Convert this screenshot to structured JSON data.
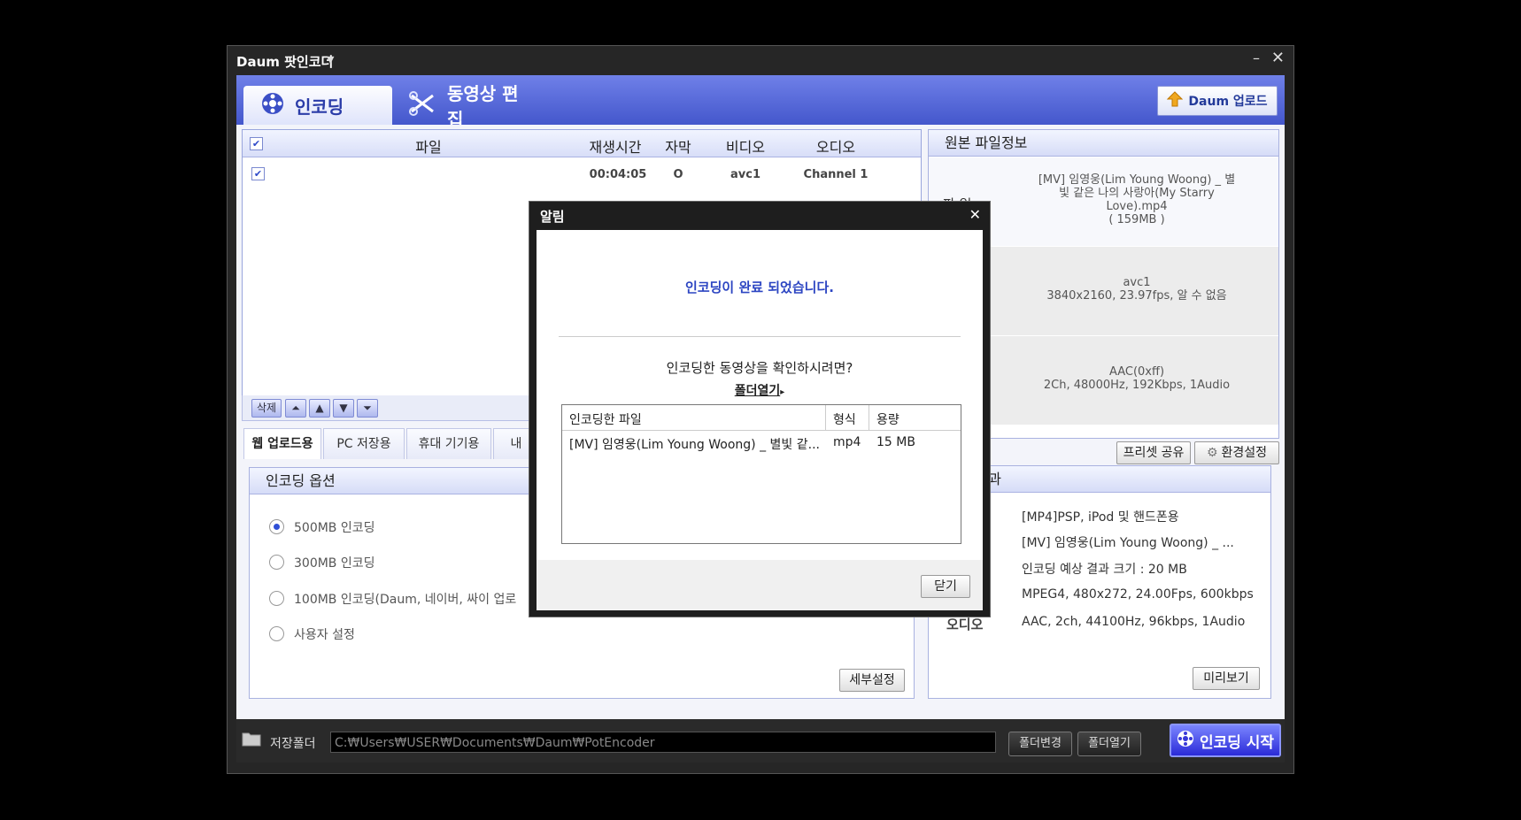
{
  "window": {
    "title": "Daum 팟인코더",
    "caret": "▼",
    "minimize": "–",
    "close": "✕"
  },
  "tabs": {
    "encode": "인코딩",
    "edit": "동영상 편집",
    "upload_btn": "Daum 업로드"
  },
  "filelist": {
    "columns": [
      "파일",
      "재생시간",
      "자막",
      "비디오",
      "오디오"
    ],
    "rows": [
      {
        "checked": true,
        "file": "",
        "duration": "00:04:05",
        "subtitle": "O",
        "video": "avc1",
        "audio": "Channel 1"
      }
    ],
    "delete_btn": "삭제",
    "arrows": [
      "⏶",
      "▲",
      "▼",
      "⏷"
    ]
  },
  "option_tabs": [
    "웹 업로드용",
    "PC 저장용",
    "휴대 기기용",
    "내"
  ],
  "encode_options": {
    "header": "인코딩 옵션",
    "items": [
      {
        "label": "500MB 인코딩",
        "selected": true
      },
      {
        "label": "300MB 인코딩",
        "selected": false
      },
      {
        "label": "100MB 인코딩(Daum, 네이버, 싸이 업로",
        "selected": false
      },
      {
        "label": "사용자 설정",
        "selected": false
      }
    ],
    "detail_btn": "세부설정"
  },
  "source_info": {
    "header": "원본 파일정보",
    "file_label": "파 일",
    "file_lines": [
      "[MV] 임영웅(Lim Young Woong) _ 별",
      "빛 같은 나의 사랑아(My Starry",
      "Love).mp4",
      "( 159MB )"
    ],
    "video_lines": [
      "avc1",
      "3840x2160, 23.97fps, 알 수 없음"
    ],
    "audio_lines": [
      "AAC(0xff)",
      "2Ch, 48000Hz, 192Kbps, 1Audio"
    ]
  },
  "preset_share_btn": "프리셋 공유",
  "settings_btn": "환경설정",
  "result": {
    "header": "코딩 결과",
    "lines": [
      "[MP4]PSP, iPod 및 핸드폰용",
      "[MV] 임영웅(Lim Young Woong) _ ...",
      "인코딩 예상 결과 크기 : 20 MB",
      "MPEG4, 480x272, 24.00Fps, 600kbps",
      "AAC, 2ch, 44100Hz, 96kbps, 1Audio"
    ],
    "audio_label": "오디오",
    "preview_btn": "미리보기"
  },
  "bottom": {
    "folder_label": "저장폴더",
    "path": "C:₩Users₩USER₩Documents₩Daum₩PotEncoder",
    "change_btn": "폴더변경",
    "open_btn": "폴더열기",
    "start_btn": "인코딩 시작"
  },
  "dialog": {
    "title": "알림",
    "close": "✕",
    "message": "인코딩이 완료 되었습니다.",
    "question": "인코딩한 동영상을 확인하시려면?",
    "link": "폴더열기",
    "link_arrow": "▸",
    "table_headers": [
      "인코딩한 파일",
      "형식",
      "용량"
    ],
    "table_row": {
      "file": "[MV] 임영웅(Lim Young Woong) _ 별빛 같...",
      "format": "mp4",
      "size": "15 MB"
    },
    "close_btn": "닫기"
  },
  "colors": {
    "accent": "#4c5cd0",
    "link_blue": "#2c45c2"
  }
}
